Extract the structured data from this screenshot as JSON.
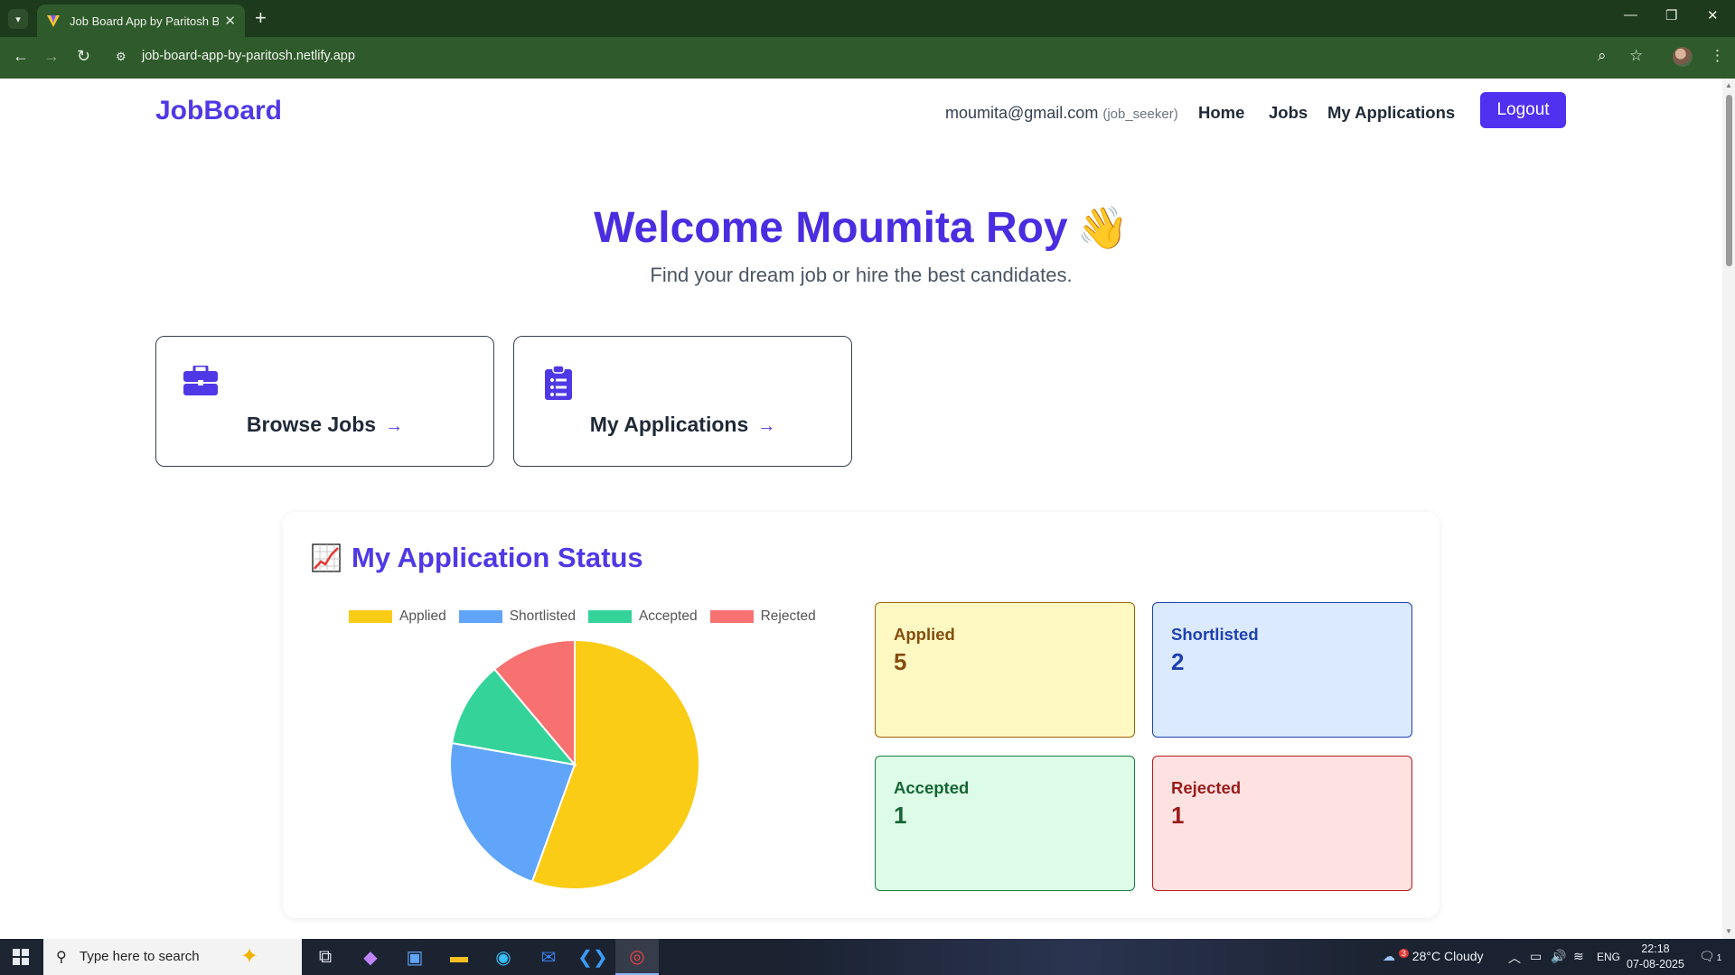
{
  "browser": {
    "tab_title": "Job Board App by Paritosh Barman",
    "url": "job-board-app-by-paritosh.netlify.app"
  },
  "header": {
    "brand": "JobBoard",
    "user_email": "moumita@gmail.com",
    "user_role": "(job_seeker)",
    "nav": [
      "Home",
      "Jobs",
      "My Applications"
    ],
    "logout_label": "Logout"
  },
  "hero": {
    "title": "Welcome Moumita Roy",
    "emoji": "👋",
    "subtitle": "Find your dream job or hire the best candidates."
  },
  "actions": [
    {
      "label": "Browse Jobs",
      "icon": "briefcase-icon"
    },
    {
      "label": "My Applications",
      "icon": "clipboard-list-icon"
    }
  ],
  "status": {
    "title": "My Application Status",
    "cards": [
      {
        "label": "Applied",
        "value": "5"
      },
      {
        "label": "Shortlisted",
        "value": "2"
      },
      {
        "label": "Accepted",
        "value": "1"
      },
      {
        "label": "Rejected",
        "value": "1"
      }
    ]
  },
  "chart_data": {
    "type": "pie",
    "categories": [
      "Applied",
      "Shortlisted",
      "Accepted",
      "Rejected"
    ],
    "values": [
      5,
      2,
      1,
      1
    ],
    "colors": [
      "#facc15",
      "#60a5fa",
      "#34d399",
      "#f87171"
    ],
    "legend_position": "top"
  },
  "colors": {
    "brand": "#4f39e6",
    "browser_green": "#2f5a2b",
    "applied_bg": "#fef9c3",
    "shortlisted_bg": "#dbeafe",
    "accepted_bg": "#dcfce7",
    "rejected_bg": "#fee2e2"
  },
  "taskbar": {
    "search_placeholder": "Type here to search",
    "weather": "28°C  Cloudy",
    "weather_badge": "3",
    "language": "ENG",
    "time": "22:18",
    "date": "07-08-2025",
    "notification_count": "1"
  }
}
